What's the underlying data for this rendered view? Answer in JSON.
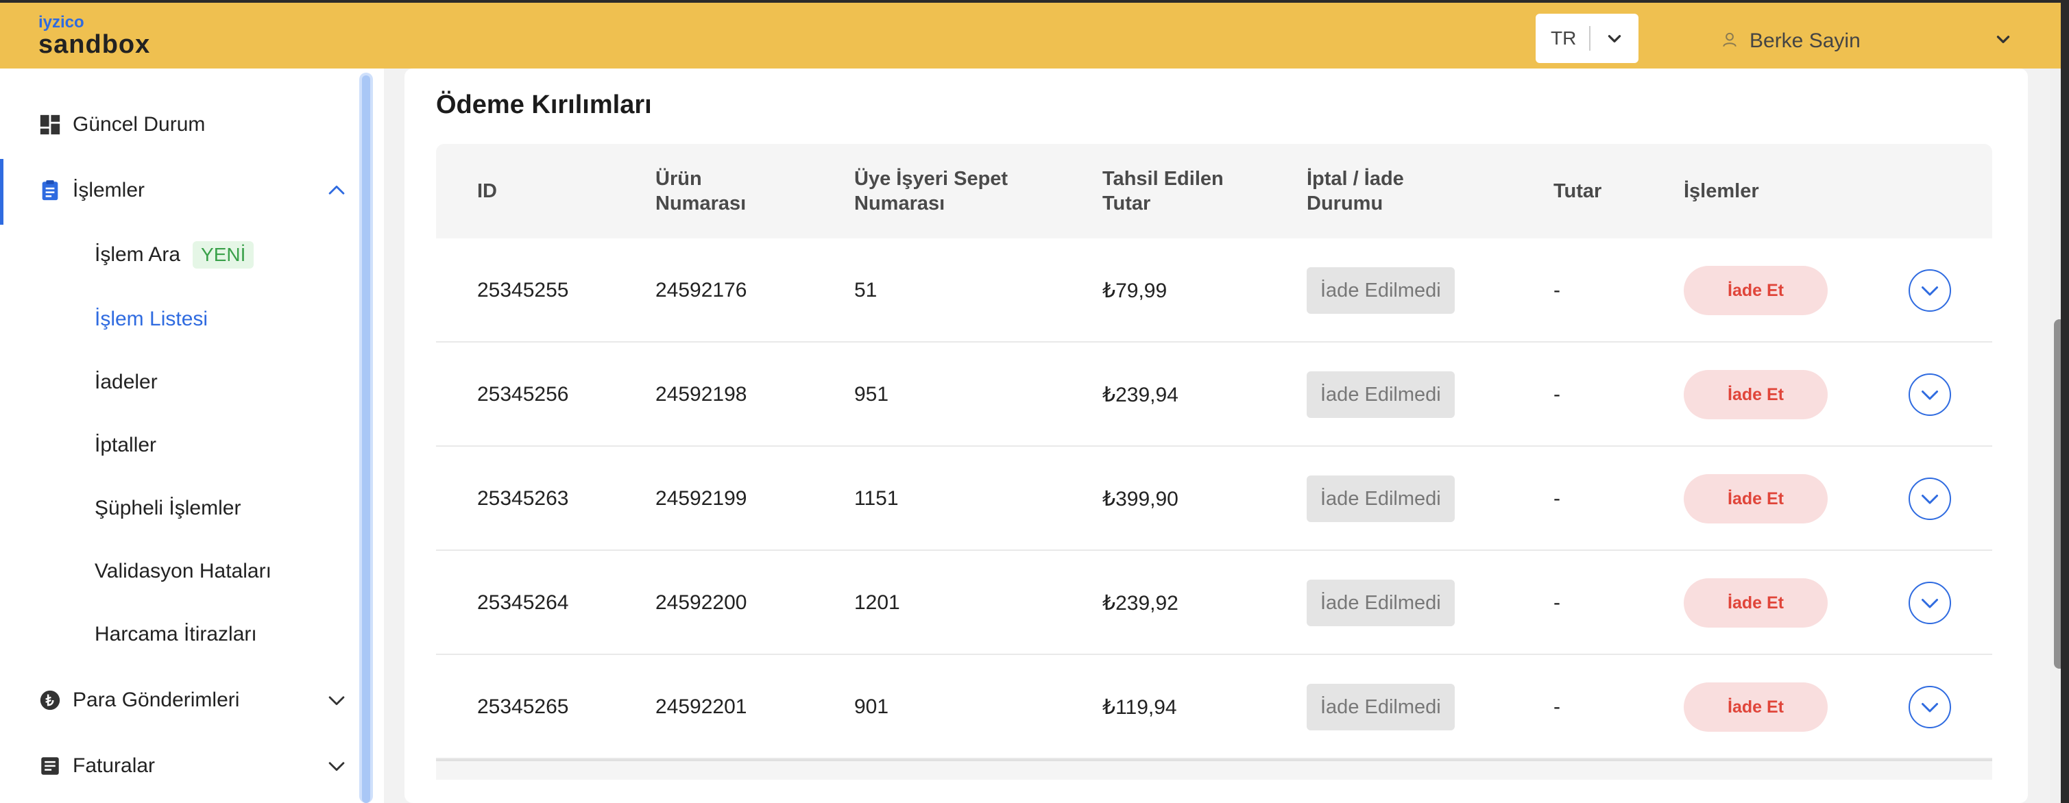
{
  "header": {
    "logo_top": "iyzico",
    "logo_bottom": "sandbox",
    "language": "TR",
    "user_name": "Berke Sayin"
  },
  "sidebar": {
    "items": [
      {
        "label": "Güncel Durum",
        "icon": "dashboard-icon"
      },
      {
        "label": "İşlemler",
        "icon": "clipboard-icon",
        "expanded": true
      },
      {
        "label": "Para Gönderimleri",
        "icon": "lira-coin-icon"
      },
      {
        "label": "Faturalar",
        "icon": "invoice-icon"
      }
    ],
    "subitems": [
      {
        "label": "İşlem Ara",
        "badge": "YENİ"
      },
      {
        "label": "İşlem Listesi",
        "active": true
      },
      {
        "label": "İadeler"
      },
      {
        "label": "İptaller"
      },
      {
        "label": "Şüpheli İşlemler"
      },
      {
        "label": "Validasyon Hataları"
      },
      {
        "label": "Harcama İtirazları"
      }
    ]
  },
  "main": {
    "title": "Ödeme Kırılımları",
    "columns": {
      "id": "ID",
      "product_1": "Ürün",
      "product_2": "Numarası",
      "basket_1": "Üye İşyeri Sepet",
      "basket_2": "Numarası",
      "collected_1": "Tahsil Edilen",
      "collected_2": "Tutar",
      "status_1": "İptal / İade",
      "status_2": "Durumu",
      "amount": "Tutar",
      "actions": "İşlemler"
    },
    "rows": [
      {
        "id": "25345255",
        "product": "24592176",
        "basket": "51",
        "collected": "₺79,99",
        "status": "İade Edilmedi",
        "amount": "-",
        "action": "İade Et"
      },
      {
        "id": "25345256",
        "product": "24592198",
        "basket": "951",
        "collected": "₺239,94",
        "status": "İade Edilmedi",
        "amount": "-",
        "action": "İade Et"
      },
      {
        "id": "25345263",
        "product": "24592199",
        "basket": "1151",
        "collected": "₺399,90",
        "status": "İade Edilmedi",
        "amount": "-",
        "action": "İade Et"
      },
      {
        "id": "25345264",
        "product": "24592200",
        "basket": "1201",
        "collected": "₺239,92",
        "status": "İade Edilmedi",
        "amount": "-",
        "action": "İade Et"
      },
      {
        "id": "25345265",
        "product": "24592201",
        "basket": "901",
        "collected": "₺119,94",
        "status": "İade Edilmedi",
        "amount": "-",
        "action": "İade Et"
      }
    ]
  },
  "colors": {
    "header_bg": "#efc050",
    "accent": "#2f6be0",
    "refund_bg": "#f9dede",
    "refund_text": "#e0453a",
    "new_badge_text": "#3aa14a"
  }
}
